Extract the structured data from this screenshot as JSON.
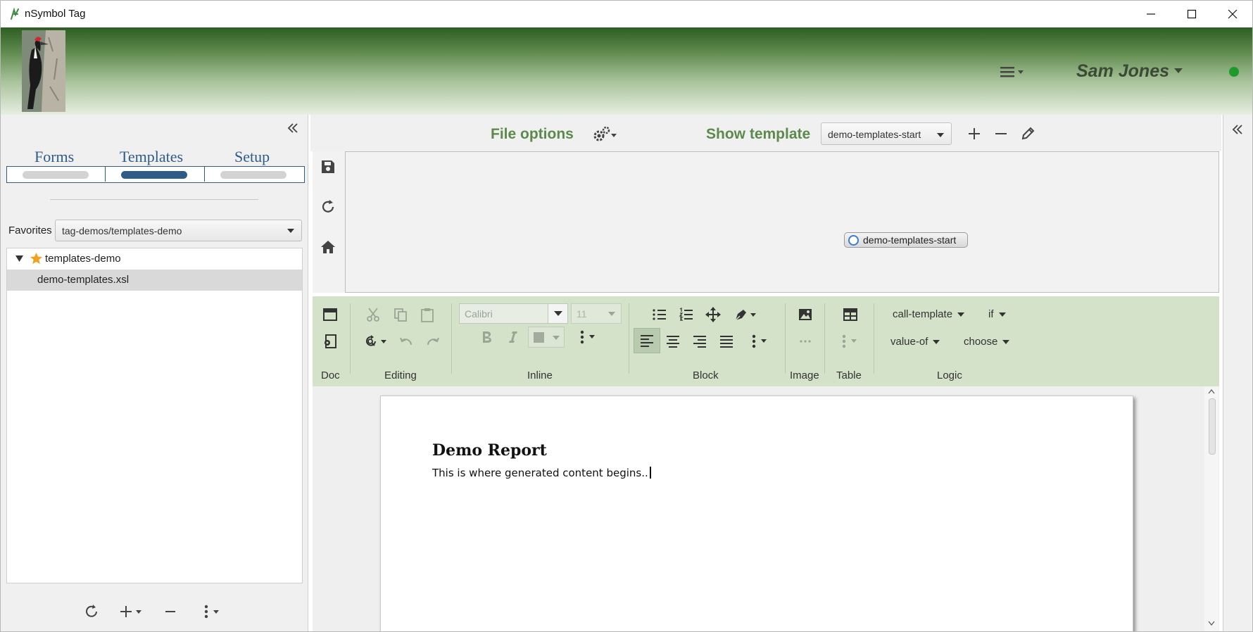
{
  "window": {
    "title": "nSymbol Tag"
  },
  "header": {
    "user_name": "Sam Jones",
    "status_color": "#1e9a2c"
  },
  "left_panel": {
    "tabs": [
      {
        "label": "Forms",
        "active": false
      },
      {
        "label": "Templates",
        "active": true
      },
      {
        "label": "Setup",
        "active": false
      }
    ],
    "favorites": {
      "label": "Favorites",
      "value": "tag-demos/templates-demo"
    },
    "tree": {
      "root": {
        "label": "templates-demo",
        "expanded": true,
        "starred": true
      },
      "children": [
        {
          "label": "demo-templates.xsl",
          "selected": true
        }
      ]
    }
  },
  "center_bar": {
    "file_options_label": "File options",
    "show_template_label": "Show template",
    "template_select_value": "demo-templates-start"
  },
  "canvas": {
    "node_label": "demo-templates-start"
  },
  "ribbon": {
    "font_name": "Calibri",
    "font_size": "11",
    "groups": [
      "Doc",
      "Editing",
      "Inline",
      "Block",
      "Image",
      "Table",
      "Logic"
    ],
    "logic_items": [
      "call-template",
      "if",
      "value-of",
      "choose"
    ]
  },
  "document": {
    "title": "Demo Report",
    "body": "This is where generated content begins.."
  },
  "colors": {
    "accent_green": "#5c8a4c",
    "tab_blue": "#2f5b86",
    "ribbon_bg": "#d3e2c9"
  }
}
